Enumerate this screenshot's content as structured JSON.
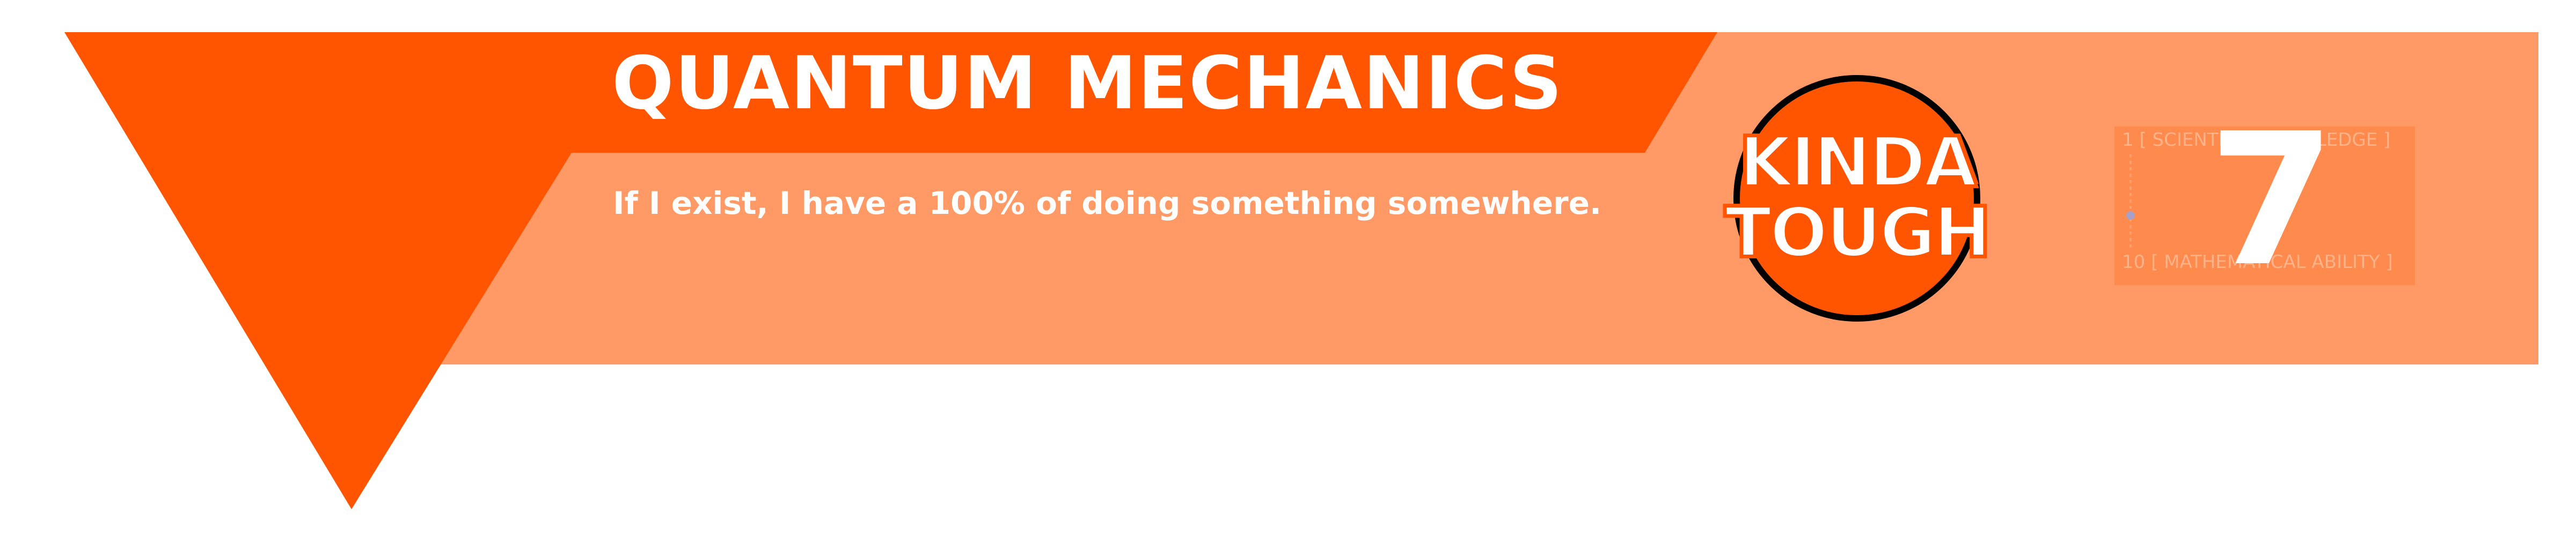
{
  "topic": {
    "title": "QUANTUM MECHANICS",
    "subtitle": "If I exist, I have a 100% of doing something somewhere."
  },
  "difficulty": {
    "line1": "KINDA",
    "line2": "TOUGH"
  },
  "scale": {
    "top_label": "1 [ SCIENTIFIC KNOWLEDGE ]",
    "bottom_label": "10 [ MATHEMATICAL ABILITY ]",
    "score": "7"
  },
  "colors": {
    "accent": "#ff5500",
    "panel": "#ff9966",
    "panel_dark": "#ff8a4d",
    "text": "#ffffff",
    "badge_ring": "#000000"
  }
}
